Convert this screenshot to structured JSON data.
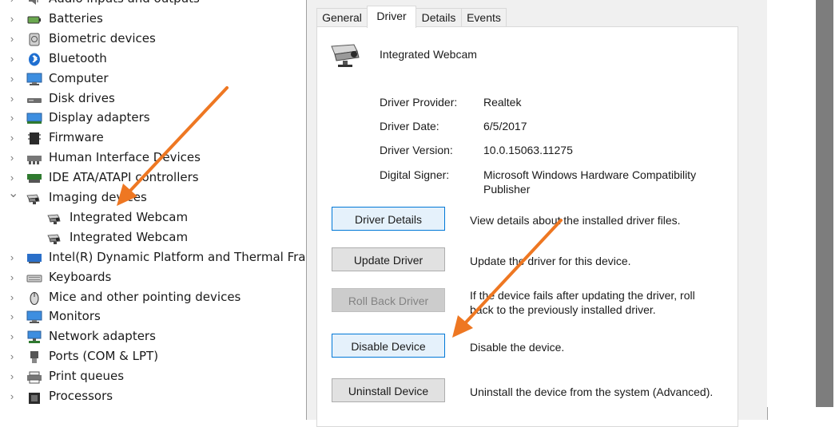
{
  "device_tree": {
    "items": [
      {
        "label": "Audio inputs and outputs",
        "icon": "speaker-icon",
        "expanded": false,
        "indent": 0
      },
      {
        "label": "Batteries",
        "icon": "battery-icon",
        "expanded": false,
        "indent": 0
      },
      {
        "label": "Biometric devices",
        "icon": "fingerprint-icon",
        "expanded": false,
        "indent": 0
      },
      {
        "label": "Bluetooth",
        "icon": "bluetooth-icon",
        "expanded": false,
        "indent": 0
      },
      {
        "label": "Computer",
        "icon": "monitor-icon",
        "expanded": false,
        "indent": 0
      },
      {
        "label": "Disk drives",
        "icon": "disk-drive-icon",
        "expanded": false,
        "indent": 0
      },
      {
        "label": "Display adapters",
        "icon": "display-adapter-icon",
        "expanded": false,
        "indent": 0
      },
      {
        "label": "Firmware",
        "icon": "firmware-icon",
        "expanded": false,
        "indent": 0
      },
      {
        "label": "Human Interface Devices",
        "icon": "hid-icon",
        "expanded": false,
        "indent": 0
      },
      {
        "label": "IDE ATA/ATAPI controllers",
        "icon": "ide-controller-icon",
        "expanded": false,
        "indent": 0
      },
      {
        "label": "Imaging devices",
        "icon": "camera-icon",
        "expanded": true,
        "indent": 0
      },
      {
        "label": "Integrated Webcam",
        "icon": "camera-icon",
        "expanded": null,
        "indent": 1
      },
      {
        "label": "Integrated Webcam",
        "icon": "camera-icon",
        "expanded": null,
        "indent": 1
      },
      {
        "label": "Intel(R) Dynamic Platform and Thermal Frame",
        "icon": "thermal-framework-icon",
        "expanded": false,
        "indent": 0
      },
      {
        "label": "Keyboards",
        "icon": "keyboard-icon",
        "expanded": false,
        "indent": 0
      },
      {
        "label": "Mice and other pointing devices",
        "icon": "mouse-icon",
        "expanded": false,
        "indent": 0
      },
      {
        "label": "Monitors",
        "icon": "monitor-icon",
        "expanded": false,
        "indent": 0
      },
      {
        "label": "Network adapters",
        "icon": "network-adapter-icon",
        "expanded": false,
        "indent": 0
      },
      {
        "label": "Ports (COM & LPT)",
        "icon": "port-icon",
        "expanded": false,
        "indent": 0
      },
      {
        "label": "Print queues",
        "icon": "printer-icon",
        "expanded": false,
        "indent": 0
      },
      {
        "label": "Processors",
        "icon": "processor-icon",
        "expanded": false,
        "indent": 0
      }
    ]
  },
  "dialog": {
    "tabs": [
      {
        "label": "General",
        "active": false
      },
      {
        "label": "Driver",
        "active": true
      },
      {
        "label": "Details",
        "active": false
      },
      {
        "label": "Events",
        "active": false
      }
    ],
    "device_name": "Integrated Webcam",
    "properties": [
      {
        "label": "Driver Provider:",
        "value": "Realtek"
      },
      {
        "label": "Driver Date:",
        "value": "6/5/2017"
      },
      {
        "label": "Driver Version:",
        "value": "10.0.15063.11275"
      },
      {
        "label": "Digital Signer:",
        "value": "Microsoft Windows Hardware Compatibility Publisher"
      }
    ],
    "buttons": [
      {
        "label": "Driver Details",
        "description": "View details about the installed driver files.",
        "state": "focused"
      },
      {
        "label": "Update Driver",
        "description": "Update the driver for this device.",
        "state": "normal"
      },
      {
        "label": "Roll Back Driver",
        "description": "If the device fails after updating the driver, roll back to the previously installed driver.",
        "state": "disabled"
      },
      {
        "label": "Disable Device",
        "description": "Disable the device.",
        "state": "highlighted"
      },
      {
        "label": "Uninstall Device",
        "description": "Uninstall the device from the system (Advanced).",
        "state": "normal"
      }
    ]
  },
  "colors": {
    "annotation_arrow": "#ee7722",
    "focus_border": "#0078d7",
    "dialog_background": "#f0f0f0"
  }
}
